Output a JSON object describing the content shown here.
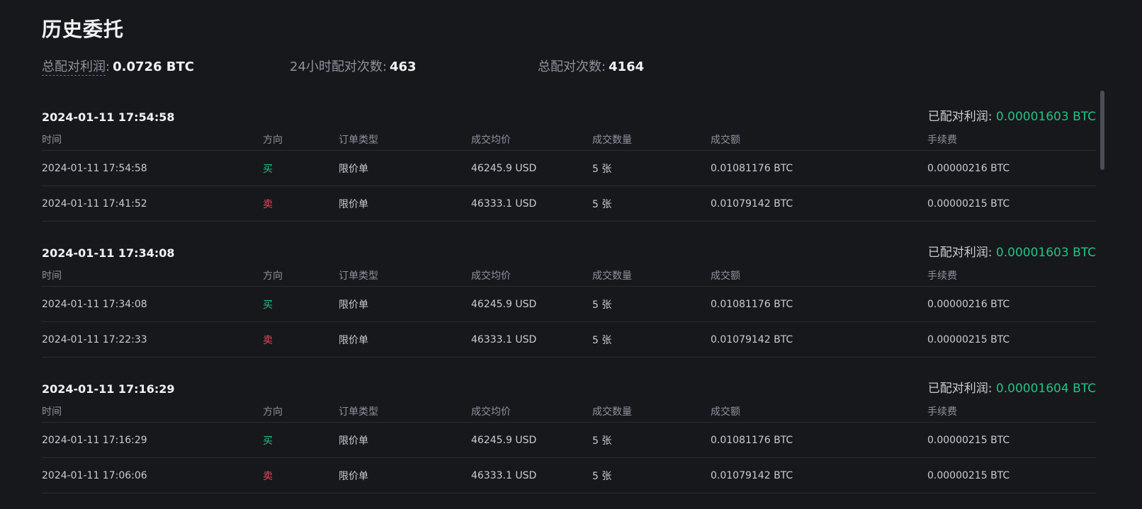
{
  "title": "历史委托",
  "stats": {
    "total_profit_label": "总配对利润",
    "total_profit_value": "0.0726 BTC",
    "pairs_24h_label": "24小时配对次数",
    "pairs_24h_value": "463",
    "total_pairs_label": "总配对次数",
    "total_pairs_value": "4164"
  },
  "columns": {
    "time": "时间",
    "direction": "方向",
    "order_type": "订单类型",
    "avg_price": "成交均价",
    "qty": "成交数量",
    "amount": "成交额",
    "fee": "手续费"
  },
  "profit_label": "已配对利润: ",
  "groups": [
    {
      "time": "2024-01-11 17:54:58",
      "profit": "0.00001603 BTC",
      "rows": [
        {
          "time": "2024-01-11 17:54:58",
          "direction": "买",
          "type": "限价单",
          "price": "46245.9 USD",
          "qty": "5 张",
          "amount": "0.01081176 BTC",
          "fee": "0.00000216 BTC"
        },
        {
          "time": "2024-01-11 17:41:52",
          "direction": "卖",
          "type": "限价单",
          "price": "46333.1 USD",
          "qty": "5 张",
          "amount": "0.01079142 BTC",
          "fee": "0.00000215 BTC"
        }
      ]
    },
    {
      "time": "2024-01-11 17:34:08",
      "profit": "0.00001603 BTC",
      "rows": [
        {
          "time": "2024-01-11 17:34:08",
          "direction": "买",
          "type": "限价单",
          "price": "46245.9 USD",
          "qty": "5 张",
          "amount": "0.01081176 BTC",
          "fee": "0.00000216 BTC"
        },
        {
          "time": "2024-01-11 17:22:33",
          "direction": "卖",
          "type": "限价单",
          "price": "46333.1 USD",
          "qty": "5 张",
          "amount": "0.01079142 BTC",
          "fee": "0.00000215 BTC"
        }
      ]
    },
    {
      "time": "2024-01-11 17:16:29",
      "profit": "0.00001604 BTC",
      "rows": [
        {
          "time": "2024-01-11 17:16:29",
          "direction": "买",
          "type": "限价单",
          "price": "46245.9 USD",
          "qty": "5 张",
          "amount": "0.01081176 BTC",
          "fee": "0.00000215 BTC"
        },
        {
          "time": "2024-01-11 17:06:06",
          "direction": "卖",
          "type": "限价单",
          "price": "46333.1 USD",
          "qty": "5 张",
          "amount": "0.01079142 BTC",
          "fee": "0.00000215 BTC"
        }
      ]
    }
  ],
  "colors": {
    "buy": "#1fc384",
    "sell": "#f0455b",
    "profit": "#1fc384",
    "background": "#17181c"
  }
}
